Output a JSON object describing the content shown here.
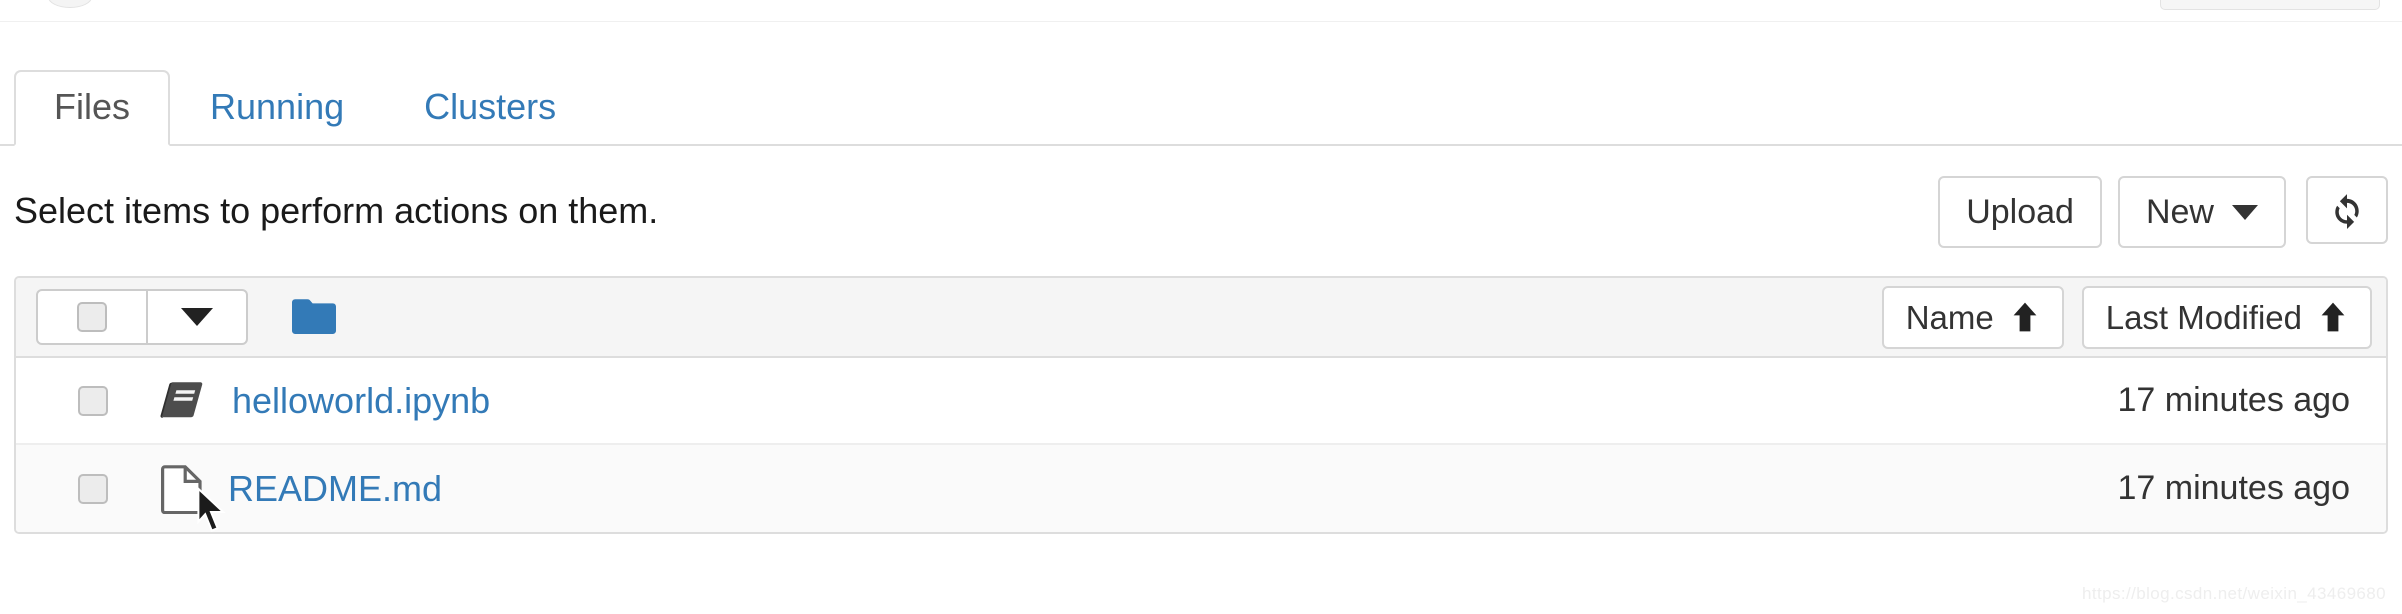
{
  "tabs": [
    {
      "label": "Files",
      "active": true
    },
    {
      "label": "Running",
      "active": false
    },
    {
      "label": "Clusters",
      "active": false
    }
  ],
  "toolbar": {
    "message": "Select items to perform actions on them.",
    "upload_label": "Upload",
    "new_label": "New",
    "refresh_icon": "refresh-icon"
  },
  "list_header": {
    "select_all_icon": "checkbox-icon",
    "select_dropdown_icon": "caret-down-icon",
    "folder_icon": "folder-icon",
    "sort_name_label": "Name",
    "sort_name_arrow": "arrow-up-icon",
    "sort_modified_label": "Last Modified",
    "sort_modified_arrow": "arrow-up-icon"
  },
  "files": [
    {
      "name": "helloworld.ipynb",
      "icon": "notebook-icon",
      "last_modified": "17 minutes ago"
    },
    {
      "name": "README.md",
      "icon": "file-icon",
      "last_modified": "17 minutes ago"
    }
  ],
  "watermark": "https://blog.csdn.net/weixin_43469680",
  "colors": {
    "link_blue": "#337ab7",
    "folder_blue": "#337ab7",
    "active_tab_text": "#555555",
    "border_gray": "#dddddd",
    "header_bg": "#f5f5f5",
    "notebook_icon": "#4d4d4d"
  }
}
